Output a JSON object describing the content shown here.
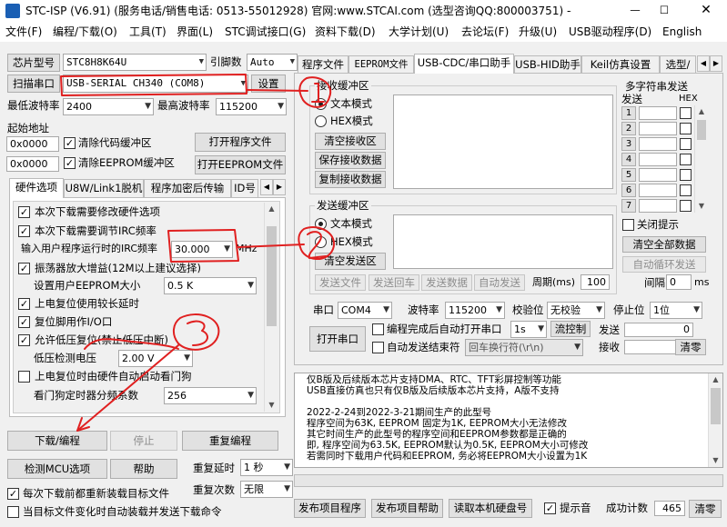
{
  "window": {
    "title": "STC-ISP (V6.91) (服务电话/销售电话: 0513-55012928) 官网:www.STCAI.com  (选型咨询QQ:800003751) -- STC: ..."
  },
  "menu": [
    "文件(F)",
    "编程/下载(O)",
    "工具(T)",
    "界面(L)",
    "STC调试接口(G)",
    "资料下载(D)",
    "大学计划(U)",
    "去论坛(F)",
    "升级(U)",
    "USB驱动程序(D)",
    "English"
  ],
  "left": {
    "chip_label": "芯片型号",
    "chip_value": "STC8H8K64U",
    "pins_label": "引脚数",
    "pins_value": "Auto",
    "scan_port": "扫描串口",
    "port_value": "USB-SERIAL CH340 (COM8)",
    "settings": "设置",
    "min_baud_label": "最低波特率",
    "min_baud": "2400",
    "max_baud_label": "最高波特率",
    "max_baud": "115200",
    "start_addr": "起始地址",
    "addr1": "0x0000",
    "clear_code": "清除代码缓冲区",
    "open_prog": "打开程序文件",
    "addr2": "0x0000",
    "clear_eeprom": "清除EEPROM缓冲区",
    "open_eeprom": "打开EEPROM文件",
    "tabs": [
      "硬件选项",
      "U8W/Link1脱机",
      "程序加密后传输",
      "ID号"
    ],
    "options": {
      "opt1": "本次下载需要修改硬件选项",
      "opt2": "本次下载需要调节IRC频率",
      "irc_label": "输入用户程序运行时的IRC频率",
      "irc_value": "30.000",
      "irc_unit": "MHz",
      "opt3": "振荡器放大增益(12M以上建议选择)",
      "eeprom_size_label": "设置用户EEPROM大小",
      "eeprom_size": "0.5 K",
      "opt4": "上电复位使用较长延时",
      "opt5": "复位脚用作I/O口",
      "opt6": "允许低压复位(禁止低压中断)",
      "lv_label": "低压检测电压",
      "lv_value": "2.00 V",
      "opt7": "上电复位时由硬件自动启动看门狗",
      "wdt_label": "看门狗定时器分频系数",
      "wdt_value": "256"
    },
    "download": "下载/编程",
    "stop": "停止",
    "reprogram": "重复编程",
    "check_mcu": "检测MCU选项",
    "help": "帮助",
    "repeat_delay_label": "重复延时",
    "repeat_delay": "1 秒",
    "repeat_count_label": "重复次数",
    "repeat_count": "无限",
    "reload_each": "每次下载前都重新装载目标文件",
    "auto_load": "当目标文件变化时自动装载并发送下载命令"
  },
  "right": {
    "tabs": [
      "程序文件",
      "EEPROM文件",
      "USB-CDC/串口助手",
      "USB-HID助手",
      "Keil仿真设置",
      "选型/"
    ],
    "recv_group": "接收缓冲区",
    "text_mode": "文本模式",
    "hex_mode": "HEX模式",
    "clear_recv": "清空接收区",
    "save_recv": "保存接收数据",
    "copy_recv": "复制接收数据",
    "send_group": "发送缓冲区",
    "send_text_mode": "文本模式",
    "send_hex_mode": "HEX模式",
    "clear_send": "清空发送区",
    "send_file": "发送文件",
    "send_enter": "发送回车",
    "send_data": "发送数据",
    "auto_send": "自动发送",
    "period_label": "周期(ms)",
    "period": "100",
    "multi_group": "多字符串发送",
    "col_send": "发送",
    "col_hex": "HEX",
    "rows": [
      "1",
      "2",
      "3",
      "4",
      "5",
      "6",
      "7"
    ],
    "close_tip": "关闭提示",
    "clear_all": "清空全部数据",
    "auto_loop": "自动循环发送",
    "interval_label": "间隔",
    "interval": "0",
    "interval_unit": "ms",
    "serial_label": "串口",
    "serial_port": "COM4",
    "baud_label": "波特率",
    "baud": "115200",
    "parity_label": "校验位",
    "parity": "无校验",
    "stop_label": "停止位",
    "stop_bits": "1位",
    "open_serial": "打开串口",
    "auto_open": "编程完成后自动打开串口",
    "delay_opt": "1s",
    "flow": "流控制",
    "send_count_label": "发送",
    "send_count": "0",
    "auto_end": "自动发送结束符",
    "end_char": "回车换行符(\\r\\n)",
    "recv_count_label": "接收",
    "recv_count": "0",
    "clear_counts": "清零"
  },
  "log": [
    "仅B版及后续版本芯片支持DMA、RTC、TFT彩屏控制等功能",
    "USB直接仿真也只有仅B版及后续版本芯片支持，A版不支持",
    "",
    "2022-2-24到2022-3-21期间生产的此型号",
    "程序空间为63K, EEPROM 固定为1K, EEPROM大小无法修改",
    "其它时间生产的此型号的程序空间和EEPROM参数都是正确的",
    "即, 程序空间为63.5K, EEPROM默认为0.5K, EEPROM大小可修改",
    "若需同时下载用户代码和EEPROM, 务必将EEPROM大小设置为1K"
  ],
  "bottom": {
    "publish_prog": "发布项目程序",
    "publish_help": "发布项目帮助",
    "read_disk": "读取本机硬盘号",
    "tip_sound": "提示音",
    "success_label": "成功计数",
    "success_count": "465",
    "clear": "清零"
  },
  "annotations": [
    "1",
    "2",
    "3"
  ]
}
